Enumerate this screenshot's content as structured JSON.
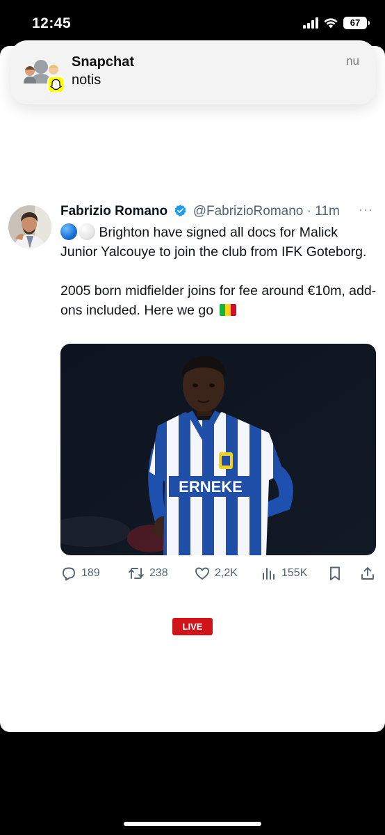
{
  "status_bar": {
    "time": "12:45",
    "battery": "67"
  },
  "notification": {
    "app": "Snapchat",
    "body": "notis",
    "time": "nu"
  },
  "tweet": {
    "author_name": "Fabrizio Romano",
    "handle": "@FabrizioRomano",
    "separator": "·",
    "time": "11m",
    "more": "···",
    "text_line1": "Brighton have signed all docs for Malick Junior Yalcouye to join the club from IFK Goteborg.",
    "text_line2": "2005 born midfielder joins for fee around €10m, add-ons included. Here we go",
    "media_text": "ERNEKE",
    "stats": {
      "replies": "189",
      "reposts": "238",
      "likes": "2,2K",
      "views": "155K"
    }
  },
  "live_badge": "LIVE",
  "colors": {
    "accent_blue": "#1d9bf0",
    "live_red": "#d0141a",
    "text": "#0f1419",
    "muted": "#536471"
  },
  "icons": [
    "signal-icon",
    "wifi-icon",
    "battery-icon",
    "snapchat-icon",
    "verified-icon",
    "more-icon",
    "reply-icon",
    "repost-icon",
    "like-icon",
    "views-icon",
    "bookmark-icon",
    "share-icon"
  ]
}
